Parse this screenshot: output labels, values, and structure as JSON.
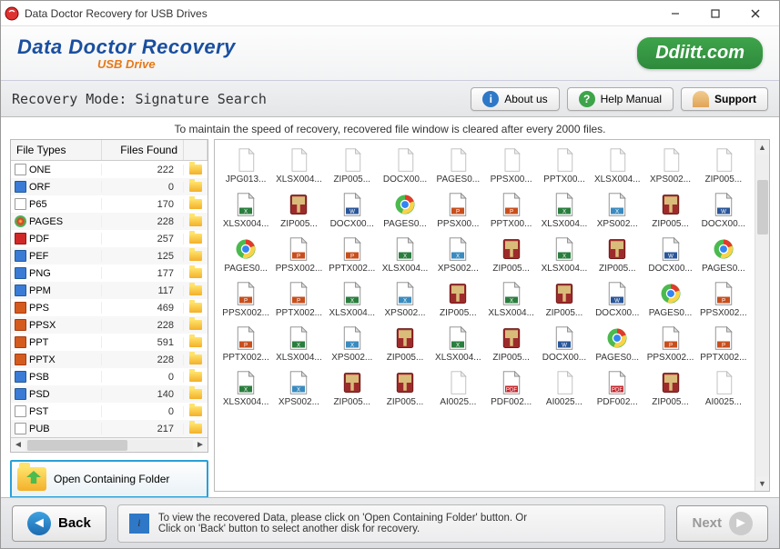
{
  "window": {
    "title": "Data Doctor Recovery for USB Drives"
  },
  "header": {
    "main": "Data Doctor Recovery",
    "sub": "USB Drive",
    "brand": "Ddiitt.com"
  },
  "toolbar": {
    "mode_label": "Recovery Mode: Signature Search",
    "about": "About us",
    "help": "Help Manual",
    "support": "Support"
  },
  "info_line": "To maintain the speed of recovery, recovered file window is cleared after every 2000 files.",
  "filetypes": {
    "headers": {
      "type": "File Types",
      "found": "Files Found"
    },
    "rows": [
      {
        "ext": "ONE",
        "count": 222,
        "kind": "doc"
      },
      {
        "ext": "ORF",
        "count": 0,
        "kind": "img"
      },
      {
        "ext": "P65",
        "count": 170,
        "kind": "doc"
      },
      {
        "ext": "PAGES",
        "count": 228,
        "kind": "pages"
      },
      {
        "ext": "PDF",
        "count": 257,
        "kind": "pdf"
      },
      {
        "ext": "PEF",
        "count": 125,
        "kind": "img"
      },
      {
        "ext": "PNG",
        "count": 177,
        "kind": "img"
      },
      {
        "ext": "PPM",
        "count": 117,
        "kind": "img"
      },
      {
        "ext": "PPS",
        "count": 469,
        "kind": "ppt"
      },
      {
        "ext": "PPSX",
        "count": 228,
        "kind": "ppt"
      },
      {
        "ext": "PPT",
        "count": 591,
        "kind": "ppt"
      },
      {
        "ext": "PPTX",
        "count": 228,
        "kind": "ppt"
      },
      {
        "ext": "PSB",
        "count": 0,
        "kind": "img"
      },
      {
        "ext": "PSD",
        "count": 140,
        "kind": "img"
      },
      {
        "ext": "PST",
        "count": 0,
        "kind": "doc"
      },
      {
        "ext": "PUB",
        "count": 217,
        "kind": "doc"
      }
    ]
  },
  "open_folder": "Open Containing Folder",
  "files": [
    {
      "name": "JPG013...",
      "kind": "blank"
    },
    {
      "name": "XLSX004...",
      "kind": "blank"
    },
    {
      "name": "ZIP005...",
      "kind": "blank"
    },
    {
      "name": "DOCX00...",
      "kind": "blank"
    },
    {
      "name": "PAGES0...",
      "kind": "blank"
    },
    {
      "name": "PPSX00...",
      "kind": "blank"
    },
    {
      "name": "PPTX00...",
      "kind": "blank"
    },
    {
      "name": "XLSX004...",
      "kind": "blank"
    },
    {
      "name": "XPS002...",
      "kind": "blank"
    },
    {
      "name": "ZIP005...",
      "kind": "blank"
    },
    {
      "name": "XLSX004...",
      "kind": "xlsx"
    },
    {
      "name": "ZIP005...",
      "kind": "zip"
    },
    {
      "name": "DOCX00...",
      "kind": "docx"
    },
    {
      "name": "PAGES0...",
      "kind": "chrome"
    },
    {
      "name": "PPSX00...",
      "kind": "ppsx"
    },
    {
      "name": "PPTX00...",
      "kind": "pptx"
    },
    {
      "name": "XLSX004...",
      "kind": "xlsx"
    },
    {
      "name": "XPS002...",
      "kind": "xps"
    },
    {
      "name": "ZIP005...",
      "kind": "zip"
    },
    {
      "name": "DOCX00...",
      "kind": "docx"
    },
    {
      "name": "PAGES0...",
      "kind": "chrome"
    },
    {
      "name": "PPSX002...",
      "kind": "ppsx"
    },
    {
      "name": "PPTX002...",
      "kind": "pptx"
    },
    {
      "name": "XLSX004...",
      "kind": "xlsx"
    },
    {
      "name": "XPS002...",
      "kind": "xps"
    },
    {
      "name": "ZIP005...",
      "kind": "zip"
    },
    {
      "name": "XLSX004...",
      "kind": "xlsx"
    },
    {
      "name": "ZIP005...",
      "kind": "zip"
    },
    {
      "name": "DOCX00...",
      "kind": "docx"
    },
    {
      "name": "PAGES0...",
      "kind": "chrome"
    },
    {
      "name": "PPSX002...",
      "kind": "ppsx"
    },
    {
      "name": "PPTX002...",
      "kind": "pptx"
    },
    {
      "name": "XLSX004...",
      "kind": "xlsx"
    },
    {
      "name": "XPS002...",
      "kind": "xps"
    },
    {
      "name": "ZIP005...",
      "kind": "zip"
    },
    {
      "name": "XLSX004...",
      "kind": "xlsx"
    },
    {
      "name": "ZIP005...",
      "kind": "zip"
    },
    {
      "name": "DOCX00...",
      "kind": "docx"
    },
    {
      "name": "PAGES0...",
      "kind": "chrome"
    },
    {
      "name": "PPSX002...",
      "kind": "ppsx"
    },
    {
      "name": "PPTX002...",
      "kind": "pptx"
    },
    {
      "name": "XLSX004...",
      "kind": "xlsx"
    },
    {
      "name": "XPS002...",
      "kind": "xps"
    },
    {
      "name": "ZIP005...",
      "kind": "zip"
    },
    {
      "name": "XLSX004...",
      "kind": "xlsx"
    },
    {
      "name": "ZIP005...",
      "kind": "zip"
    },
    {
      "name": "DOCX00...",
      "kind": "docx"
    },
    {
      "name": "PAGES0...",
      "kind": "chrome"
    },
    {
      "name": "PPSX002...",
      "kind": "ppsx"
    },
    {
      "name": "PPTX002...",
      "kind": "pptx"
    },
    {
      "name": "XLSX004...",
      "kind": "xlsx"
    },
    {
      "name": "XPS002...",
      "kind": "xps"
    },
    {
      "name": "ZIP005...",
      "kind": "zip"
    },
    {
      "name": "ZIP005...",
      "kind": "zip"
    },
    {
      "name": "AI0025...",
      "kind": "blank"
    },
    {
      "name": "PDF002...",
      "kind": "pdf"
    },
    {
      "name": "AI0025...",
      "kind": "blank"
    },
    {
      "name": "PDF002...",
      "kind": "pdf"
    },
    {
      "name": "ZIP005...",
      "kind": "zip"
    },
    {
      "name": "AI0025...",
      "kind": "blank"
    }
  ],
  "footer": {
    "back": "Back",
    "next": "Next",
    "info1": "To view the recovered Data, please click on 'Open Containing Folder' button. Or",
    "info2": "Click on 'Back' button to select another disk for recovery."
  }
}
